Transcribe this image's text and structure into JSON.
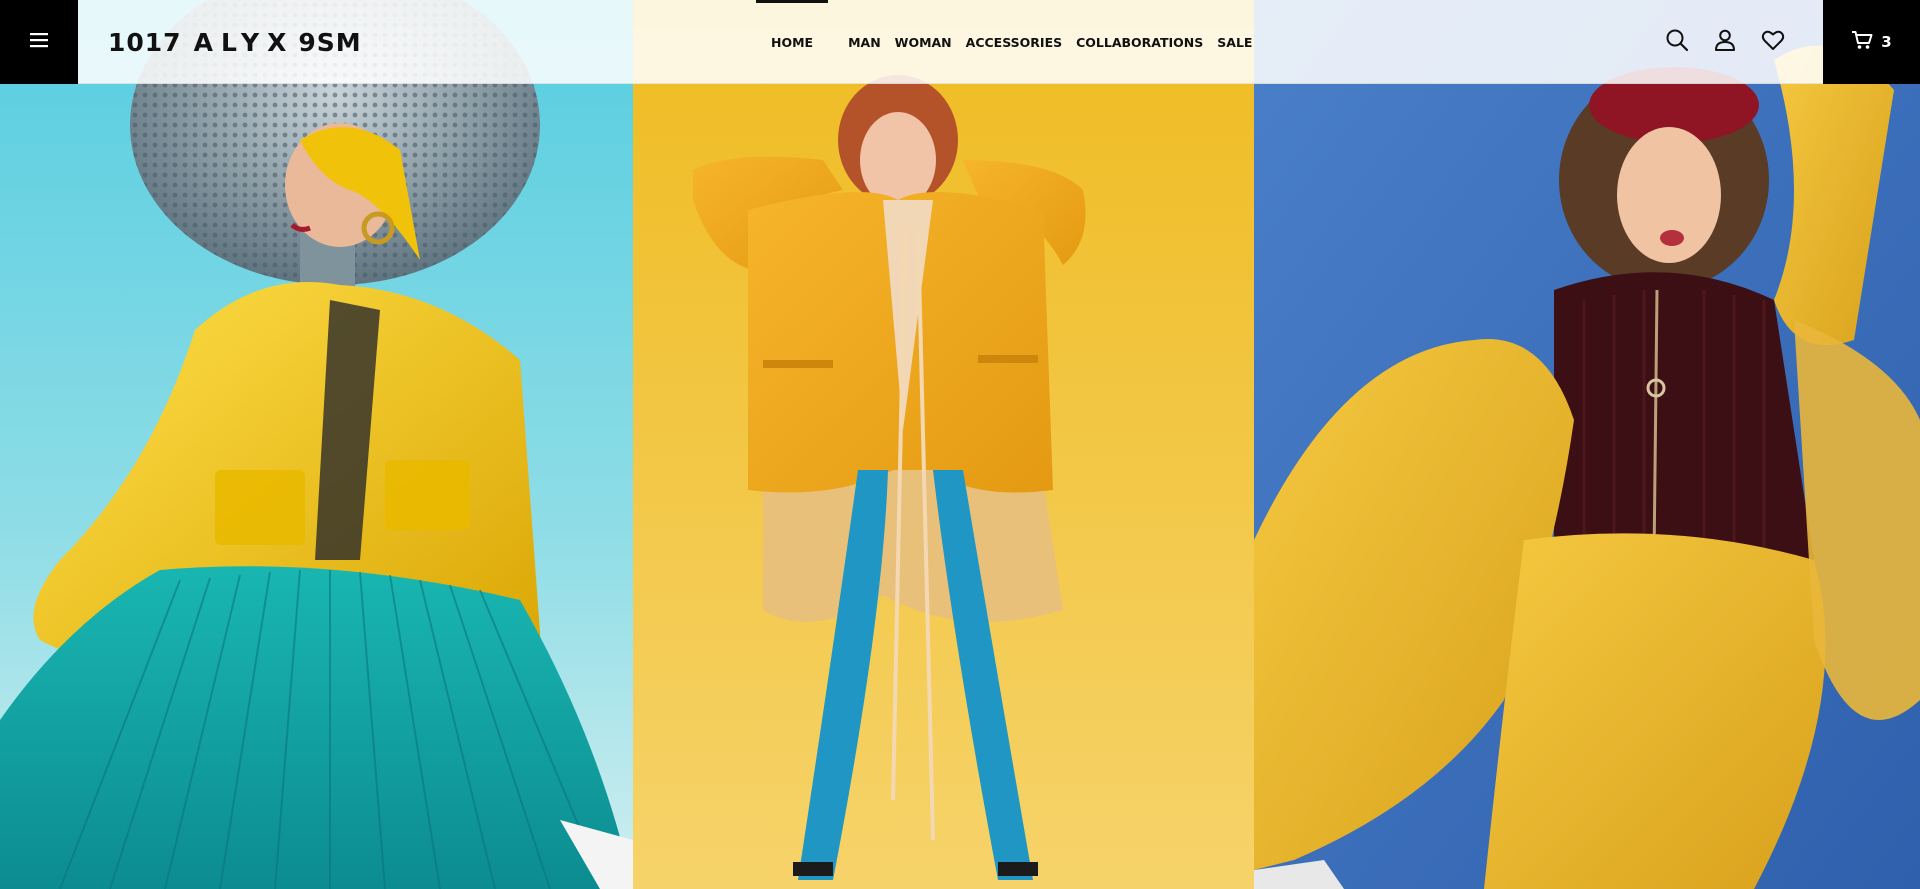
{
  "brand": {
    "part1": "1017",
    "part2": "ALYX",
    "part3": "9SM"
  },
  "nav": {
    "items": [
      {
        "label": "HOME",
        "active": true
      },
      {
        "label": "MAN"
      },
      {
        "label": "WOMAN"
      },
      {
        "label": "ACCESSORIES"
      },
      {
        "label": "COLLABORATIONS"
      },
      {
        "label": "SALE"
      }
    ]
  },
  "header_icons": [
    "menu-icon",
    "search-icon",
    "user-icon",
    "heart-icon",
    "cart-icon"
  ],
  "cart": {
    "count": "3"
  },
  "colors": {
    "header_black": "#000000",
    "panel_left_sky": "#5fd0e0",
    "panel_middle_yellow": "#f2bd2a",
    "panel_right_blue": "#3a6fbd",
    "accent_yellow": "#f3c51a",
    "accent_teal": "#1aa9a8"
  },
  "hero": {
    "panels": [
      {
        "name": "hooded-yellow-jacket-look"
      },
      {
        "name": "orange-blazer-look"
      },
      {
        "name": "yellow-knit-look"
      }
    ]
  }
}
